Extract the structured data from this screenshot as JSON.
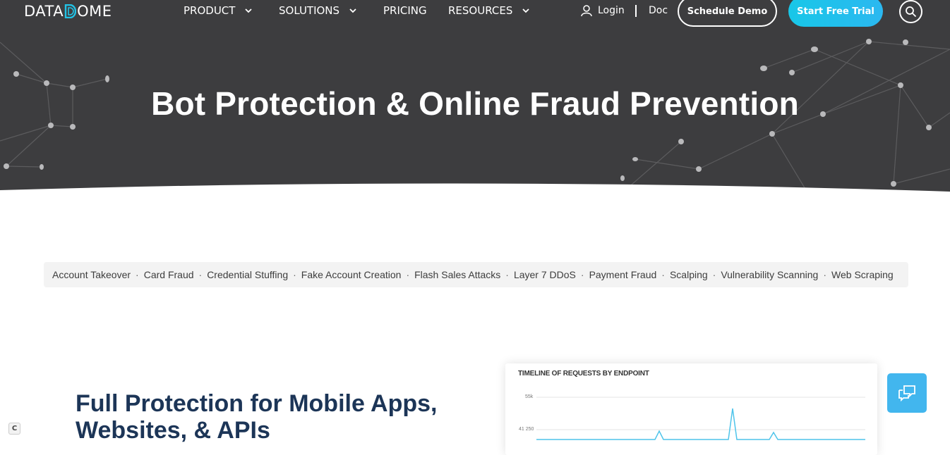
{
  "nav": {
    "logo_left": "DATA",
    "logo_right": "OME",
    "items": [
      {
        "label": "PRODUCT",
        "has_dropdown": true
      },
      {
        "label": "SOLUTIONS",
        "has_dropdown": true
      },
      {
        "label": "PRICING",
        "has_dropdown": false
      },
      {
        "label": "RESOURCES",
        "has_dropdown": true
      }
    ],
    "login": "Login",
    "doc": "Doc",
    "demo_button": "Schedule Demo",
    "trial_button": "Start Free Trial",
    "search_icon": "search-icon"
  },
  "hero": {
    "title": "Bot Protection & Online Fraud Prevention"
  },
  "tags": [
    "Account Takeover",
    "Card Fraud",
    "Credential Stuffing",
    "Fake Account Creation",
    "Flash Sales Attacks",
    "Layer 7 DDoS",
    "Payment Fraud",
    "Scalping",
    "Vulnerability Scanning",
    "Web Scraping"
  ],
  "feature": {
    "headline": "Full Protection for Mobile Apps, Websites, & APIs"
  },
  "chart_card": {
    "title": "TIMELINE OF REQUESTS BY ENDPOINT",
    "ticks": [
      "55k",
      "41 250"
    ]
  },
  "colors": {
    "hero_bg": "#3d3d3f",
    "accent": "#22c3e6",
    "headline": "#1c3557",
    "chat_button": "#42b6ee"
  }
}
